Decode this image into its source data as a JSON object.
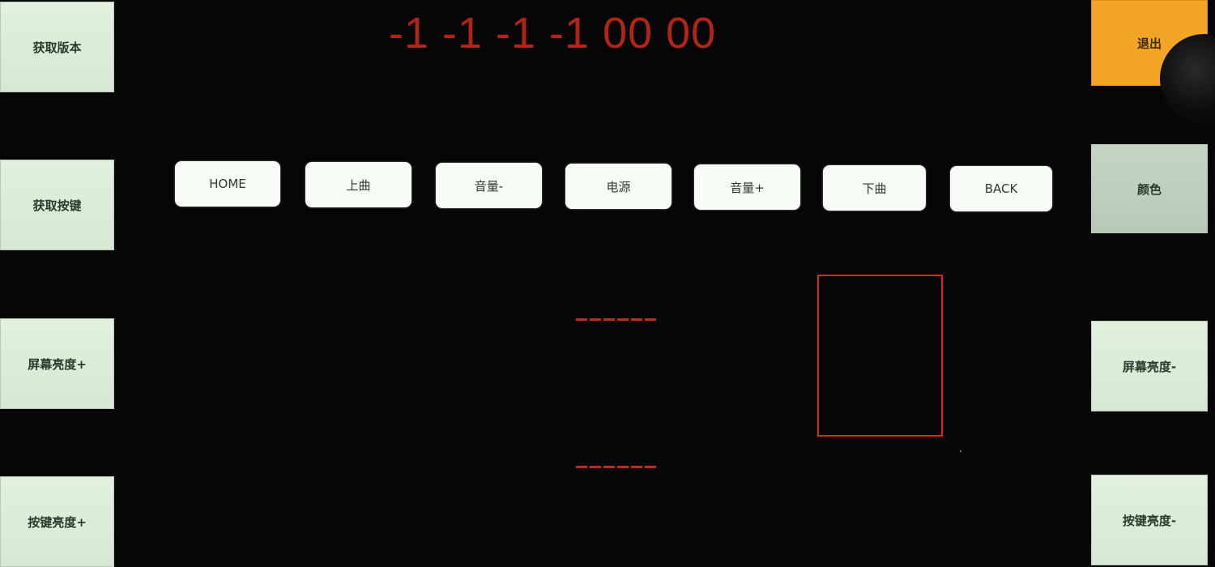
{
  "counter_text": "-1 -1 -1 -1 00 00",
  "left_buttons": [
    {
      "label": "获取版本"
    },
    {
      "label": "获取按键"
    },
    {
      "label": "屏幕亮度+"
    },
    {
      "label": "按键亮度+"
    }
  ],
  "right_buttons": [
    {
      "label": "退出"
    },
    {
      "label": "颜色"
    },
    {
      "label": "屏幕亮度-"
    },
    {
      "label": "按键亮度-"
    }
  ],
  "key_buttons": [
    {
      "label": "HOME"
    },
    {
      "label": "上曲"
    },
    {
      "label": "音量-"
    },
    {
      "label": "电源"
    },
    {
      "label": "音量+"
    },
    {
      "label": "下曲"
    },
    {
      "label": "BACK"
    }
  ],
  "colors": {
    "exit_accent": "#f2a424",
    "counter_red": "#b32414",
    "box_red": "#e0251b",
    "button_green": "#d6e8d3"
  }
}
